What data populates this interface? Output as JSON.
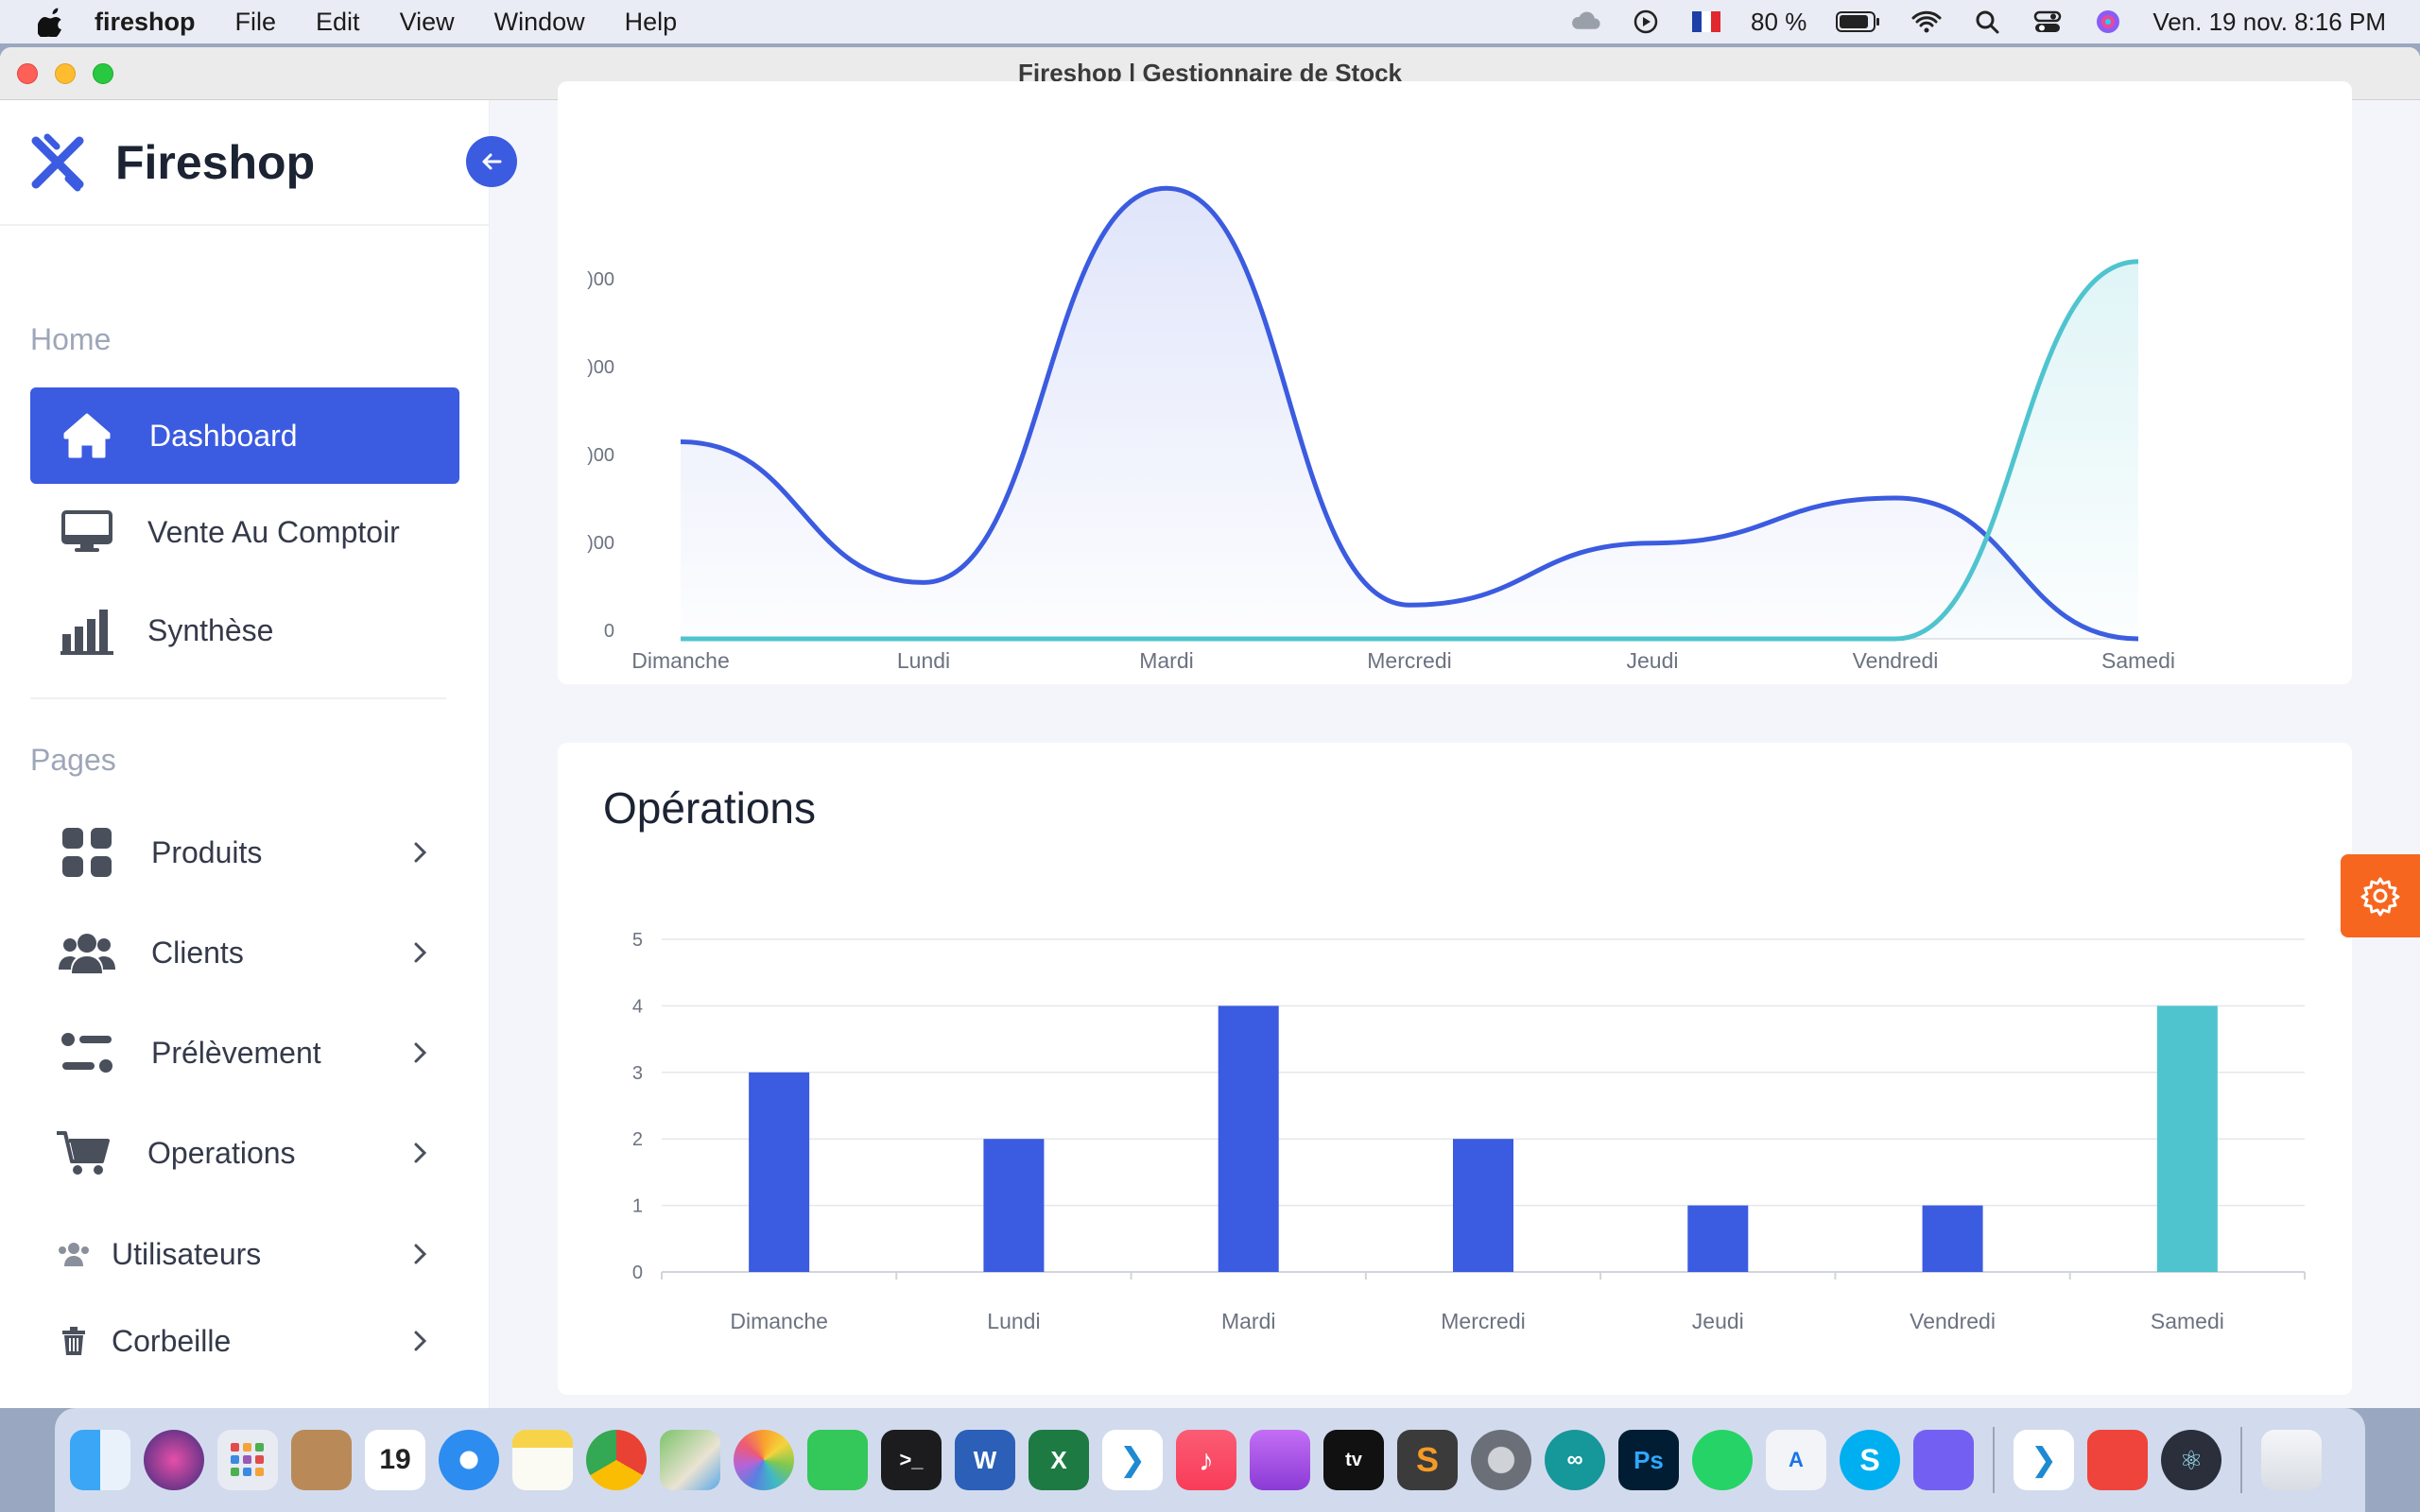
{
  "menubar": {
    "app_name": "fireshop",
    "menus": [
      "File",
      "Edit",
      "View",
      "Window",
      "Help"
    ],
    "battery": "80 %",
    "datetime": "Ven. 19 nov.  8:16 PM"
  },
  "window": {
    "title": "Fireshop | Gestionnaire de Stock"
  },
  "sidebar": {
    "brand": "Fireshop",
    "home_label": "Home",
    "pages_label": "Pages",
    "items": [
      {
        "label": "Dashboard",
        "icon": "home-icon"
      },
      {
        "label": "Vente Au Comptoir",
        "icon": "monitor-icon"
      },
      {
        "label": "Synthèse",
        "icon": "bar-chart-icon"
      },
      {
        "label": "Produits",
        "icon": "grid-icon"
      },
      {
        "label": "Clients",
        "icon": "users-icon"
      },
      {
        "label": "Prélèvement",
        "icon": "sliders-icon"
      },
      {
        "label": "Operations",
        "icon": "cart-icon"
      },
      {
        "label": "Utilisateurs",
        "icon": "user-group-icon"
      },
      {
        "label": "Corbeille",
        "icon": "trash-icon"
      }
    ]
  },
  "colors": {
    "accent": "#3b5be0",
    "teal": "#4fc4cf",
    "fab": "#f7661f"
  },
  "chart_data": [
    {
      "type": "area",
      "title": "",
      "categories": [
        "Dimanche",
        "Lundi",
        "Mardi",
        "Mercredi",
        "Jeudi",
        "Vendredi",
        "Samedi"
      ],
      "y_tick_labels": [
        ")00",
        ")00",
        ")00",
        ")00",
        "0"
      ],
      "series": [
        {
          "values": [
            1750,
            500,
            4000,
            300,
            850,
            1250,
            0
          ]
        },
        {
          "values": [
            0,
            0,
            0,
            0,
            0,
            0,
            3350
          ]
        }
      ]
    },
    {
      "type": "bar",
      "title": "Opérations",
      "categories": [
        "Dimanche",
        "Lundi",
        "Mardi",
        "Mercredi",
        "Jeudi",
        "Vendredi",
        "Samedi"
      ],
      "ylim": [
        0,
        5
      ],
      "y_ticks": [
        "0",
        "1",
        "2",
        "3",
        "4",
        "5"
      ],
      "values": [
        3,
        2,
        4,
        2,
        1,
        1,
        4
      ],
      "bar_colors": [
        "#3b5be0",
        "#3b5be0",
        "#3b5be0",
        "#3b5be0",
        "#3b5be0",
        "#3b5be0",
        "#4fc4cf"
      ]
    }
  ]
}
